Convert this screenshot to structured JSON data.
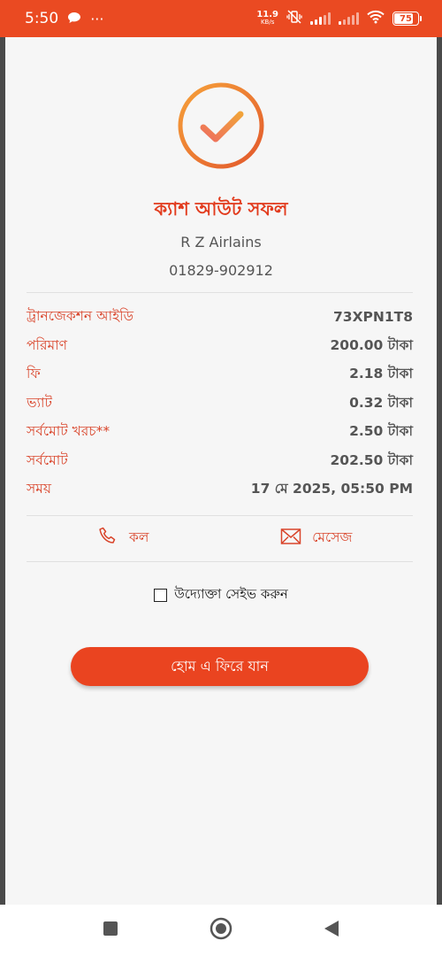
{
  "status_bar": {
    "time": "5:50",
    "chat_icon": "chat-bubble-icon",
    "more": "···",
    "net_speed_value": "11.9",
    "net_speed_unit": "KB/s",
    "battery_level": "75"
  },
  "result": {
    "title": "ক্যাশ আউট সফল",
    "merchant_name": "R Z Airlains",
    "merchant_phone": "01829-902912",
    "accent_color": "#ea4a22"
  },
  "details": [
    {
      "label": "ট্রানজেকশন আইডি",
      "value": "73XPN1T8"
    },
    {
      "label": "পরিমাণ",
      "value": "200.00 টাকা"
    },
    {
      "label": "ফি",
      "value": "2.18 টাকা"
    },
    {
      "label": "ভ্যাট",
      "value": "0.32 টাকা"
    },
    {
      "label": "সর্বমোট খরচ**",
      "value": "2.50 টাকা"
    },
    {
      "label": "সর্বমোট",
      "value": "202.50 টাকা"
    },
    {
      "label": "সময়",
      "value": "17 মে 2025, 05:50 PM"
    }
  ],
  "actions": {
    "call_label": "কল",
    "message_label": "মেসেজ"
  },
  "save_merchant": {
    "label": "উদ্যোক্তা সেইভ করুন",
    "checked": false
  },
  "home_button": {
    "label": "হোম এ ফিরে যান"
  }
}
